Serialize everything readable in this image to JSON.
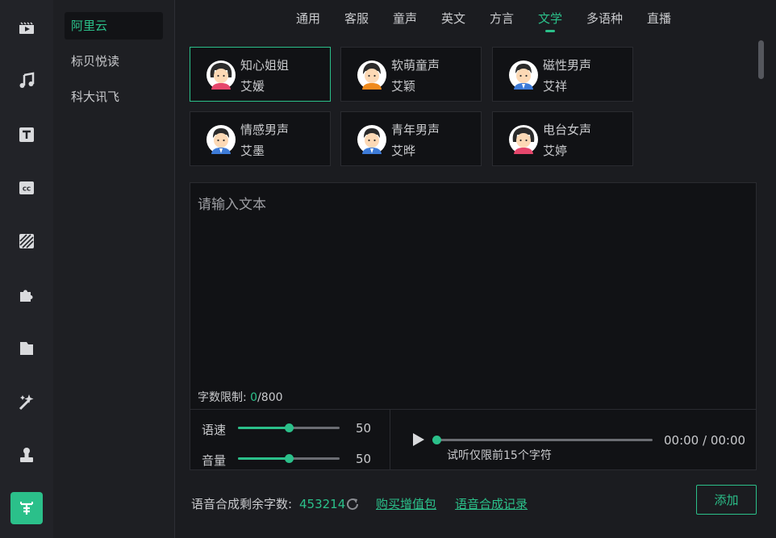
{
  "rail": {
    "icons": [
      "media-icon",
      "music-icon",
      "text-icon",
      "caption-icon",
      "filter-icon",
      "plugin-icon",
      "folder-icon",
      "effect-icon",
      "sticker-icon",
      "tts-icon"
    ]
  },
  "providers": [
    "阿里云",
    "标贝悦读",
    "科大讯飞"
  ],
  "tabs": [
    "通用",
    "客服",
    "童声",
    "英文",
    "方言",
    "文学",
    "多语种",
    "直播"
  ],
  "voices": [
    {
      "name": "知心姐姐",
      "sub": "艾媛"
    },
    {
      "name": "软萌童声",
      "sub": "艾颖"
    },
    {
      "name": "磁性男声",
      "sub": "艾祥"
    },
    {
      "name": "情感男声",
      "sub": "艾墨"
    },
    {
      "name": "青年男声",
      "sub": "艾晔"
    },
    {
      "name": "电台女声",
      "sub": "艾婷"
    }
  ],
  "textbox": {
    "placeholder": "请输入文本",
    "limit_label": "字数限制: ",
    "count": "0",
    "max": "/800"
  },
  "speed": {
    "label": "语速",
    "value": "50",
    "level": 0.5
  },
  "volume": {
    "label": "音量",
    "value": "50",
    "level": 0.5
  },
  "preview": {
    "time": "00:00 / 00:00",
    "hint": "试听仅限前15个字符",
    "progress": 0
  },
  "footer": {
    "remain_label": "语音合成剩余字数:",
    "remain_value": "453214",
    "buy_link": "购买增值包",
    "history_link": "语音合成记录",
    "add_button": "添加"
  },
  "colors": {
    "accent": "#2bc08a",
    "bg": "#1b1c20",
    "panel": "#111215"
  }
}
